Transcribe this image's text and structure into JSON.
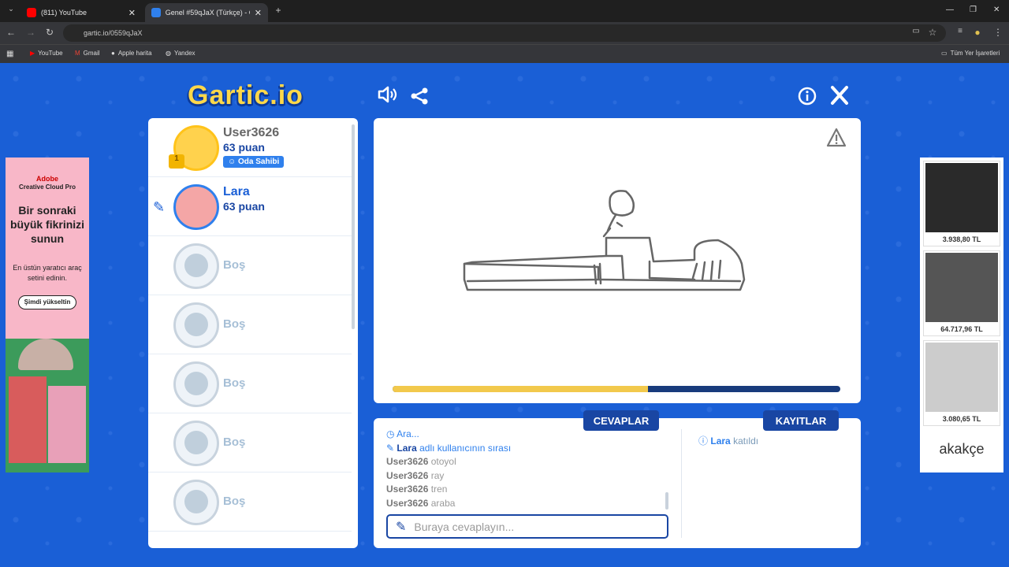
{
  "browser": {
    "tabs": [
      {
        "title": "(811) YouTube"
      },
      {
        "title": "Genel #59qJaX (Türkçe) - Gartic"
      }
    ],
    "url": "gartic.io/0559qJaX",
    "bookmarks": [
      "YouTube",
      "Gmail",
      "Apple harita",
      "Yandex"
    ],
    "all_bookmarks": "Tüm Yer İşaretleri"
  },
  "game": {
    "logo": "Gartic.io",
    "players": [
      {
        "name": "User3626",
        "points": "63 puan",
        "badge": "Oda Sahibi"
      },
      {
        "name": "Lara",
        "points": "63 puan"
      },
      {
        "name": "Boş"
      },
      {
        "name": "Boş"
      },
      {
        "name": "Boş"
      },
      {
        "name": "Boş"
      },
      {
        "name": "Boş"
      }
    ],
    "progress_fraction": 0.57,
    "answers_tab": "CEVAPLAR",
    "logs_tab": "KAYITLAR",
    "answers": [
      {
        "text": "Ara..."
      },
      {
        "user": "Lara",
        "text": "adlı kullanıcının sırası"
      },
      {
        "user": "User3626",
        "text": "otoyol"
      },
      {
        "user": "User3626",
        "text": "ray"
      },
      {
        "user": "User3626",
        "text": "tren"
      },
      {
        "user": "User3626",
        "text": "araba"
      }
    ],
    "input_placeholder": "Buraya cevaplayın...",
    "log_user": "Lara",
    "log_text": "katıldı"
  },
  "ads": {
    "left": {
      "brand": "Adobe",
      "product": "Creative Cloud Pro",
      "headline": "Bir sonraki büyük fikrinizi sunun",
      "body": "En üstün yaratıcı araç setini edinin.",
      "cta": "Şimdi yükseltin"
    },
    "right": {
      "prices": [
        "3.938,80 TL",
        "64.717,96 TL",
        "3.080,65 TL"
      ],
      "brand": "akakçe"
    }
  }
}
